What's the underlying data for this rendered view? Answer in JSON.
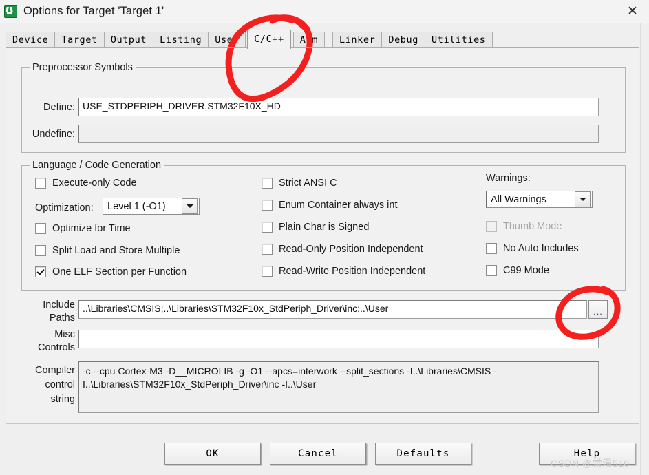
{
  "window": {
    "title": "Options for Target 'Target 1'",
    "app_icon": "keil-uvision-icon",
    "close_icon": "close-icon"
  },
  "tabs": [
    {
      "label": "Device",
      "active": false
    },
    {
      "label": "Target",
      "active": false
    },
    {
      "label": "Output",
      "active": false
    },
    {
      "label": "Listing",
      "active": false
    },
    {
      "label": "User",
      "active": false
    },
    {
      "label": "C/C++",
      "active": true
    },
    {
      "label": "Asm",
      "active": false
    },
    {
      "label": "Linker",
      "active": false
    },
    {
      "label": "Debug",
      "active": false
    },
    {
      "label": "Utilities",
      "active": false
    }
  ],
  "preprocessor": {
    "legend": "Preprocessor Symbols",
    "define_label": "Define:",
    "define_value": "USE_STDPERIPH_DRIVER,STM32F10X_HD",
    "undefine_label": "Undefine:",
    "undefine_value": ""
  },
  "language": {
    "legend": "Language / Code Generation",
    "execute_only_label": "Execute-only Code",
    "execute_only_checked": false,
    "optimization_label": "Optimization:",
    "optimization_value": "Level 1 (-O1)",
    "optimize_for_time_label": "Optimize for Time",
    "optimize_for_time_checked": false,
    "split_load_store_label": "Split Load and Store Multiple",
    "split_load_store_checked": false,
    "one_elf_section_label": "One ELF Section per Function",
    "one_elf_section_checked": true,
    "strict_ansi_label": "Strict ANSI C",
    "strict_ansi_checked": false,
    "enum_container_label": "Enum Container always int",
    "enum_container_checked": false,
    "plain_char_label": "Plain Char is Signed",
    "plain_char_checked": false,
    "read_only_pi_label": "Read-Only Position Independent",
    "read_only_pi_checked": false,
    "read_write_pi_label": "Read-Write Position Independent",
    "read_write_pi_checked": false,
    "warnings_label": "Warnings:",
    "warnings_value": "All Warnings",
    "thumb_mode_label": "Thumb Mode",
    "thumb_mode_checked": false,
    "thumb_mode_disabled": true,
    "no_auto_includes_label": "No Auto Includes",
    "no_auto_includes_checked": false,
    "c99_mode_label": "C99 Mode",
    "c99_mode_checked": false
  },
  "paths": {
    "include_label_line1": "Include",
    "include_label_line2": "Paths",
    "include_value": "..\\Libraries\\CMSIS;..\\Libraries\\STM32F10x_StdPeriph_Driver\\inc;..\\User",
    "browse_label": "...",
    "misc_label_line1": "Misc",
    "misc_label_line2": "Controls",
    "misc_value": "",
    "compiler_label_line1": "Compiler",
    "compiler_label_line2": "control",
    "compiler_label_line3": "string",
    "compiler_value": "-c --cpu Cortex-M3 -D__MICROLIB -g -O1 --apcs=interwork --split_sections -I..\\Libraries\\CMSIS -I..\\Libraries\\STM32F10x_StdPeriph_Driver\\inc -I..\\User"
  },
  "footer": {
    "ok": "OK",
    "cancel": "Cancel",
    "defaults": "Defaults",
    "help": "Help",
    "watermark": "CSDN @常温510"
  },
  "annotations": {
    "accent_color": "#f42020",
    "circle_tab": "red-circle-around-cc-tab",
    "circle_browse": "red-circle-around-browse-button"
  }
}
